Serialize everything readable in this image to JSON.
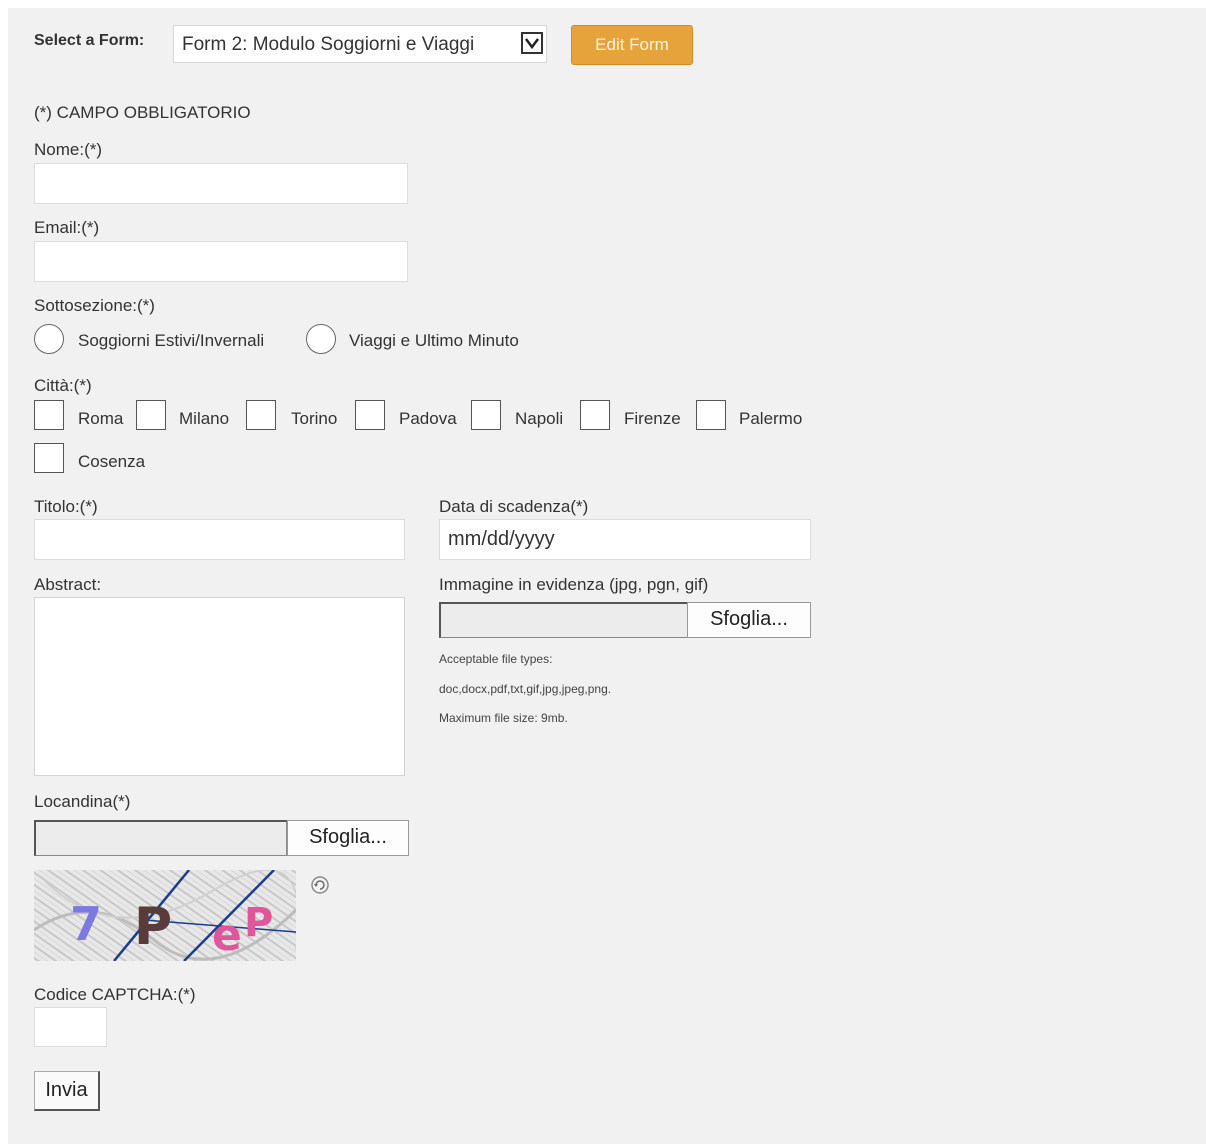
{
  "selector": {
    "label": "Select a Form:",
    "selected": "Form 2: Modulo Soggiorni e Viaggi",
    "edit_button": "Edit Form"
  },
  "form": {
    "required_note": "(*) CAMPO OBBLIGATORIO",
    "nome_label": "Nome:(*)",
    "email_label": "Email:(*)",
    "sottosezione_label": "Sottosezione:(*)",
    "sottosezione_options": [
      "Soggiorni Estivi/Invernali",
      "Viaggi e Ultimo Minuto"
    ],
    "citta_label": "Città:(*)",
    "citta_options": [
      "Roma",
      "Milano",
      "Torino",
      "Padova",
      "Napoli",
      "Firenze",
      "Palermo",
      "Cosenza"
    ],
    "titolo_label": "Titolo:(*)",
    "scadenza_label": "Data di scadenza(*)",
    "scadenza_placeholder": "mm/dd/yyyy",
    "abstract_label": "Abstract:",
    "immagine_label": "Immagine in evidenza (jpg, pgn, gif)",
    "browse_label": "Sfoglia...",
    "file_types_line1": "Acceptable file types:",
    "file_types_line2": "doc,docx,pdf,txt,gif,jpg,jpeg,png.",
    "file_size": "Maximum file size: 9mb.",
    "locandina_label": "Locandina(*)",
    "captcha_text": "7PeP",
    "captcha_label": "Codice CAPTCHA:(*)",
    "submit_label": "Invia"
  },
  "colors": {
    "accent": "#e6a33c",
    "background": "#f1f1f1"
  },
  "icons": {
    "select_arrow": "chevron-down-icon",
    "captcha_refresh": "refresh-icon"
  }
}
